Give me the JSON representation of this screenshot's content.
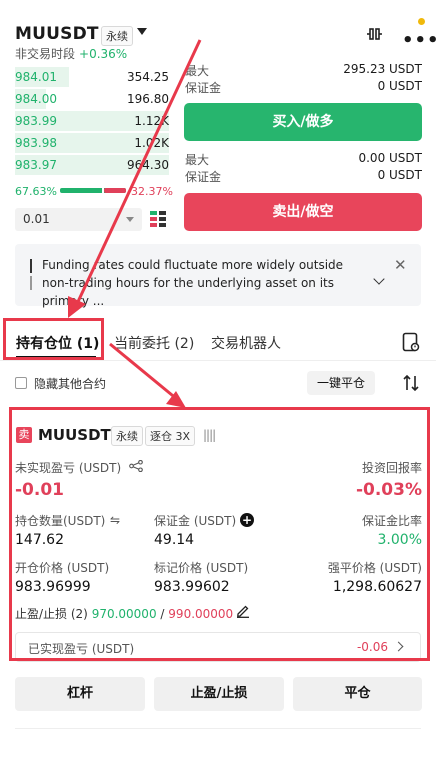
{
  "header": {
    "symbol": "MUUSDT",
    "contract_type": "永续",
    "session": "非交易时段",
    "change_pct": "+0.36%",
    "notification_dot_color": "#f0b90b"
  },
  "order_book": {
    "bids": [
      {
        "price": "984.01",
        "qty": "354.25",
        "depth": 0.35
      },
      {
        "price": "984.00",
        "qty": "196.80",
        "depth": 0.2
      },
      {
        "price": "983.99",
        "qty": "1.12K",
        "depth": 0.55
      },
      {
        "price": "983.98",
        "qty": "1.02K",
        "depth": 0.5
      },
      {
        "price": "983.97",
        "qty": "964.30",
        "depth": 0.45
      }
    ],
    "buy_ratio": "67.63%",
    "sell_ratio": "32.37%",
    "precision": "0.01"
  },
  "trade_panel": {
    "buy": {
      "max_label": "最大",
      "max_value": "295.23 USDT",
      "margin_label": "保证金",
      "margin_value": "0 USDT",
      "button": "买入/做多"
    },
    "sell": {
      "max_label": "最大",
      "max_value": "0.00 USDT",
      "margin_label": "保证金",
      "margin_value": "0 USDT",
      "button": "卖出/做空"
    }
  },
  "notice": {
    "text": "Funding rates could fluctuate more widely outside non-trading hours for the underlying asset on its primary ..."
  },
  "tabs": [
    {
      "label": "持有仓位 (1)",
      "active": true
    },
    {
      "label": "当前委托 (2)",
      "active": false
    },
    {
      "label": "交易机器人",
      "active": false
    }
  ],
  "filter": {
    "hide_other": "隐藏其他合约",
    "close_all": "一键平仓"
  },
  "position": {
    "side": "卖",
    "symbol": "MUUSDT",
    "type": "永续",
    "mode": "逐仓 3X",
    "unrealized_label": "未实现盈亏 (USDT)",
    "unrealized_value": "-0.01",
    "roi_label": "投资回报率",
    "roi_value": "-0.03%",
    "size_label": "持仓数量(USDT)",
    "size_value": "147.62",
    "margin_label": "保证金 (USDT)",
    "margin_value": "49.14",
    "margin_ratio_label": "保证金比率",
    "margin_ratio_value": "3.00%",
    "entry_label": "开仓价格 (USDT)",
    "entry_value": "983.96999",
    "mark_label": "标记价格 (USDT)",
    "mark_value": "983.99602",
    "liq_label": "强平价格 (USDT)",
    "liq_value": "1,298.60627",
    "tpsl_label": "止盈/止损 (2)",
    "tp_value": "970.00000",
    "sl_value": "990.00000",
    "realized_label": "已实现盈亏 (USDT)",
    "realized_value": "-0.06"
  },
  "actions": {
    "leverage": "杠杆",
    "tpsl": "止盈/止损",
    "close": "平仓"
  }
}
